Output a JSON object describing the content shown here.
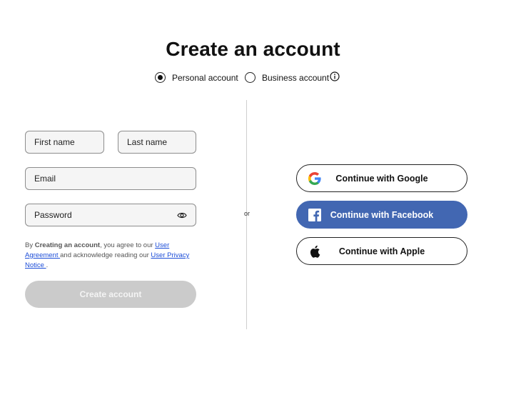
{
  "title": "Create an account",
  "account_type": {
    "options": [
      {
        "label": "Personal account",
        "selected": true
      },
      {
        "label": "Business account",
        "selected": false
      }
    ]
  },
  "form": {
    "first_name_placeholder": "First name",
    "last_name_placeholder": "Last name",
    "email_placeholder": "Email",
    "password_placeholder": "Password",
    "terms": {
      "prefix": "By ",
      "bold": "Creating an account",
      "middle1": ", you agree to our ",
      "link1": "User Agreement ",
      "middle2": "and acknowledge reading our ",
      "link2": "User Privacy Notice ",
      "suffix": "."
    },
    "submit_label": "Create account"
  },
  "divider_label": "or",
  "social": {
    "google_label": "Continue with Google",
    "facebook_label": "Continue with Facebook",
    "apple_label": "Continue with Apple"
  },
  "colors": {
    "facebook": "#4267b2",
    "disabled_button": "#cbcbcb",
    "link": "#1d4ed8"
  }
}
